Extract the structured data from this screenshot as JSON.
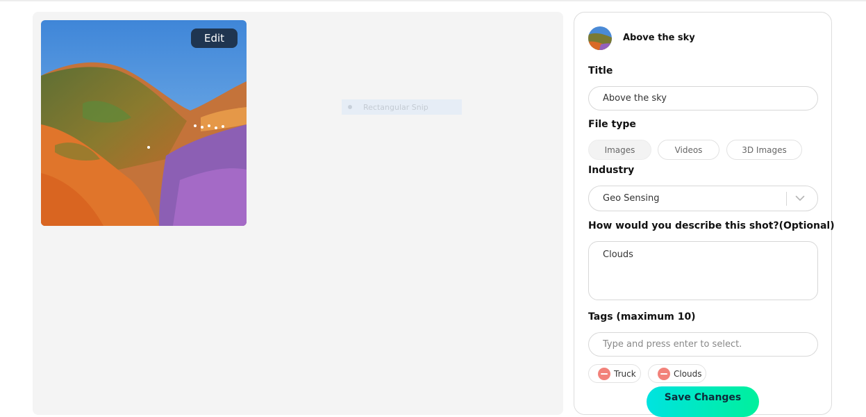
{
  "preview": {
    "edit_label": "Edit",
    "snip_label": "Rectangular Snip"
  },
  "owner": {
    "name": "Above the sky"
  },
  "form": {
    "title_label": "Title",
    "title_value": "Above the sky",
    "file_type_label": "File type",
    "file_types": [
      {
        "label": "Images",
        "selected": true
      },
      {
        "label": "Videos",
        "selected": false
      },
      {
        "label": "3D Images",
        "selected": false
      }
    ],
    "industry_label": "Industry",
    "industry_value": "Geo Sensing",
    "description_label": "How would you describe this shot?(Optional)",
    "description_value": "Clouds",
    "tags_label": "Tags (maximum 10)",
    "tags_placeholder": "Type and press enter to select.",
    "tags": [
      "Truck",
      "Clouds"
    ],
    "save_label": "Save Changes"
  },
  "colors": {
    "accent_gradient_start": "#00e3e0",
    "accent_gradient_end": "#00f09c",
    "edit_button_bg": "#1f3550",
    "tag_remove": "#f2827a"
  }
}
